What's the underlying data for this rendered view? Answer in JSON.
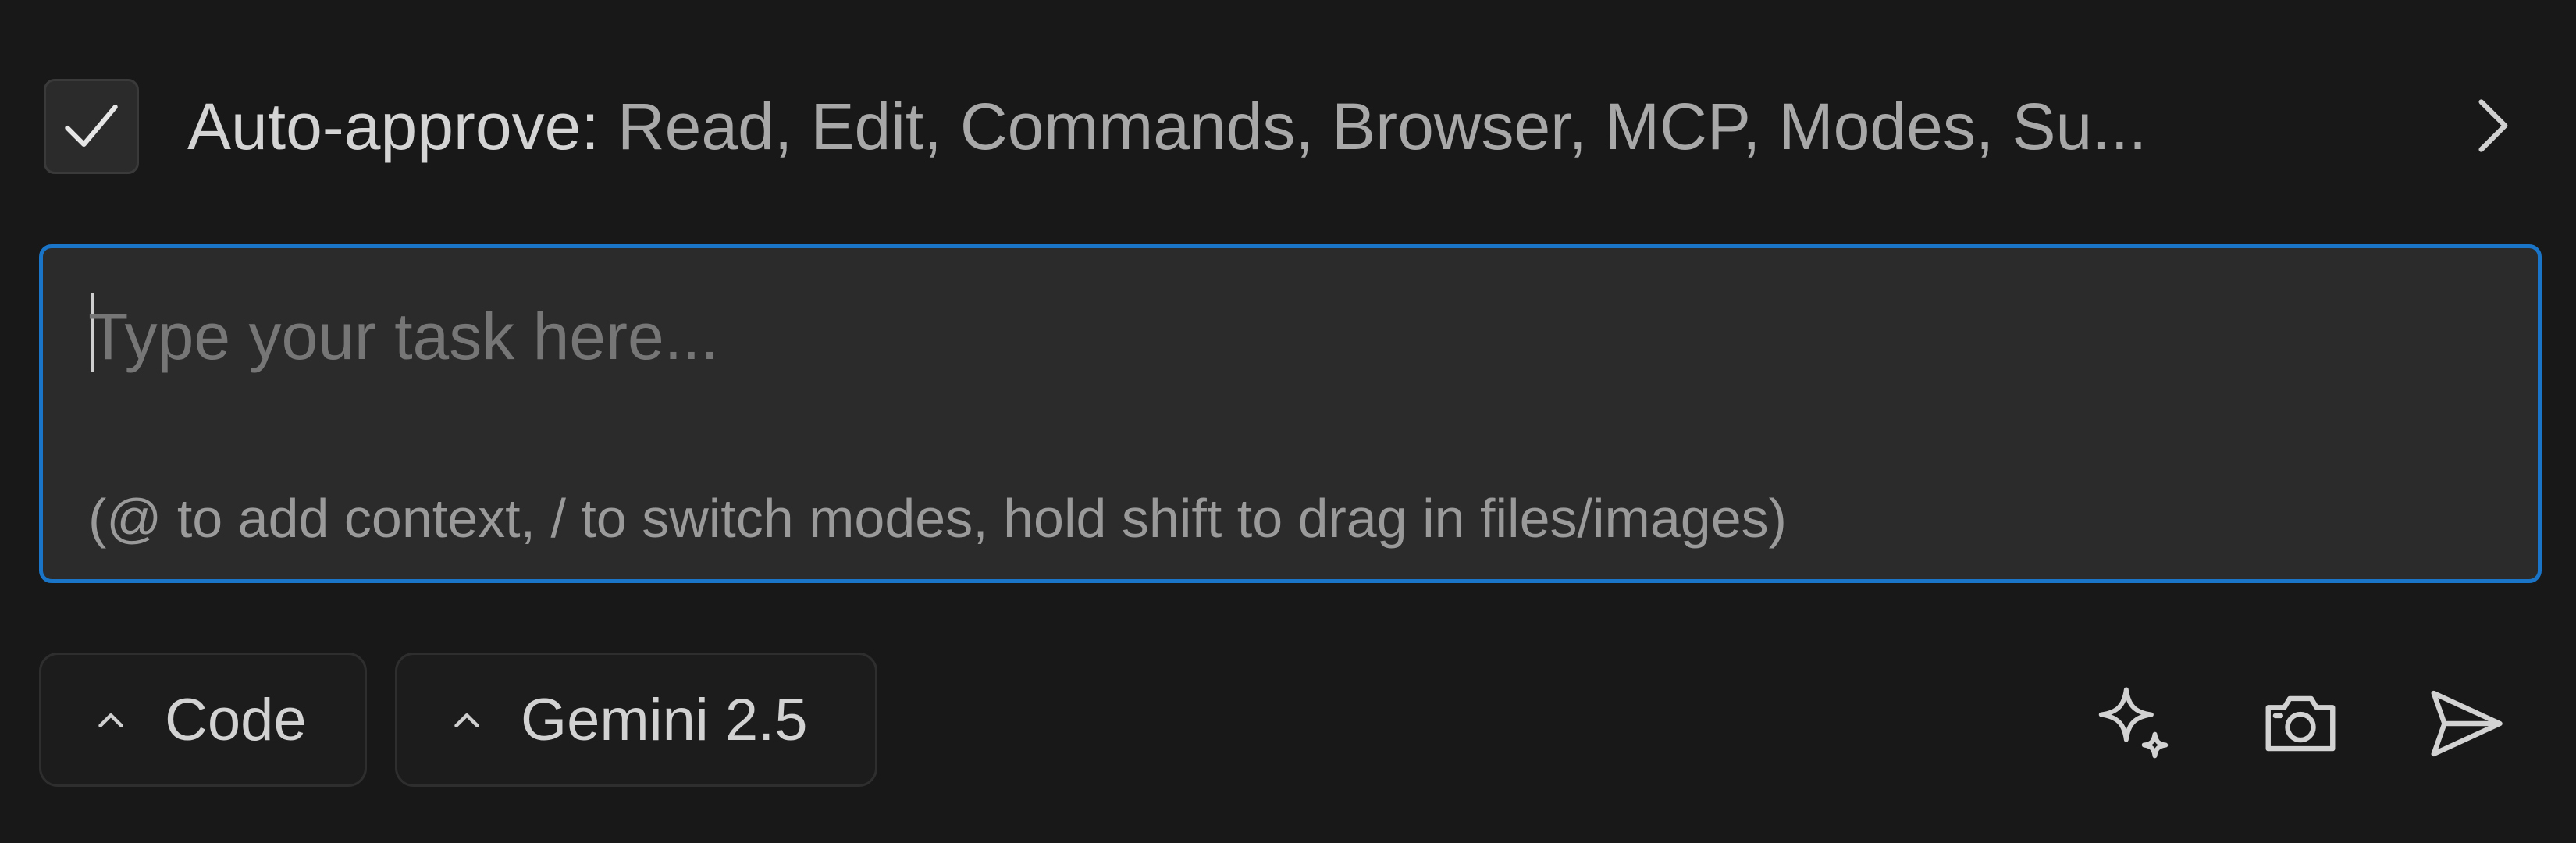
{
  "auto_approve": {
    "checked": true,
    "label": "Auto-approve:",
    "summary": "Read, Edit, Commands, Browser, MCP, Modes, Su..."
  },
  "task_input": {
    "placeholder": "Type your task here...",
    "hint": "(@ to add context, / to switch modes, hold shift to drag in files/images)",
    "focus_color": "#1a75c8"
  },
  "toolbar": {
    "mode_label": "Code",
    "model_label": "Gemini 2.5",
    "icons": [
      "sparkle-icon",
      "camera-icon",
      "send-icon"
    ]
  },
  "colors": {
    "background": "#181818",
    "input_background": "#2b2b2b",
    "accent": "#1a75c8"
  }
}
